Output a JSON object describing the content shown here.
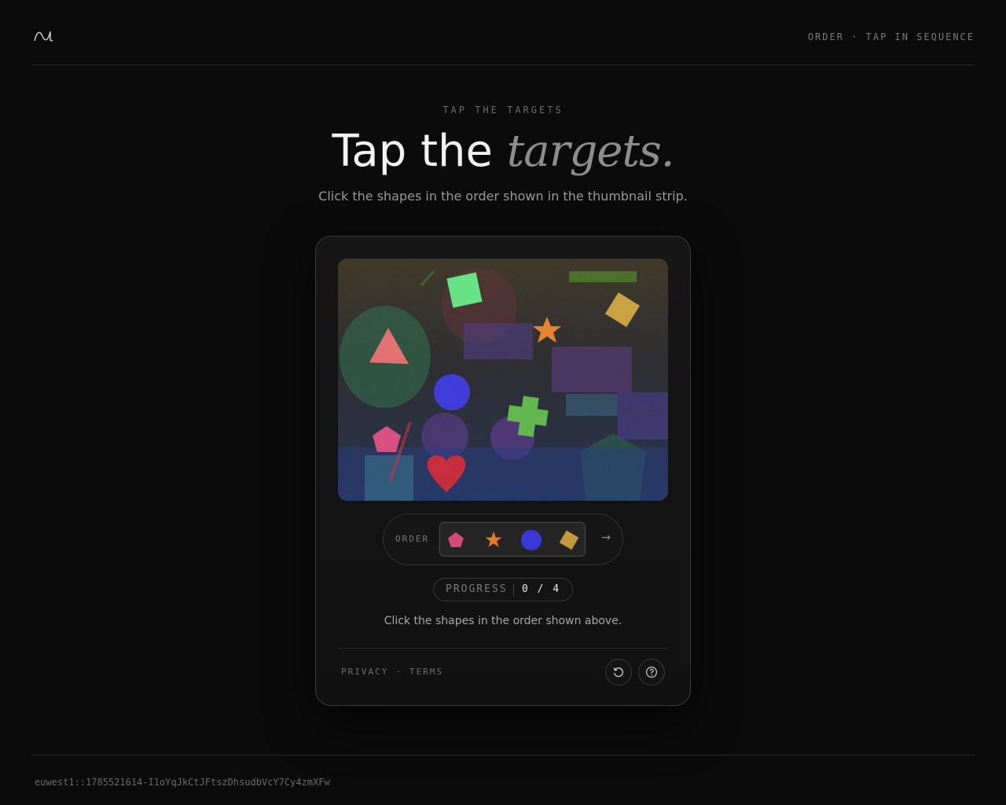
{
  "header": {
    "logo_icon": "wave-logo-icon",
    "status": "ORDER · TAP IN SEQUENCE"
  },
  "hero": {
    "eyebrow": "TAP THE TARGETS",
    "title_plain": "Tap the ",
    "title_emphasis": "targets.",
    "subtitle": "Click the shapes in the order shown in the thumbnail strip."
  },
  "challenge": {
    "canvas_shapes": [
      "square",
      "diamond",
      "star",
      "triangle",
      "circle",
      "cross",
      "pentagon",
      "heart"
    ],
    "order": {
      "label": "ORDER",
      "thumbnails": [
        {
          "shape": "pentagon",
          "color": "#d44a78"
        },
        {
          "shape": "star",
          "color": "#e27a2e"
        },
        {
          "shape": "circle",
          "color": "#3a38d6"
        },
        {
          "shape": "diamond",
          "color": "#c49a3e"
        }
      ],
      "next_icon": "arrow-right-icon"
    },
    "progress": {
      "label": "PROGRESS",
      "value": "0 / 4",
      "current": 0,
      "total": 4
    },
    "instructions": "Click the shapes in the order shown above.",
    "footer": {
      "privacy": "PRIVACY",
      "separator": "·",
      "terms": "TERMS",
      "refresh_icon": "refresh-icon",
      "help_icon": "help-icon"
    }
  },
  "page_footer": {
    "session_id": "euwest1::1785521614-I1oYqJkCtJFtszDhsudbVcY7Cy4zmXFw"
  }
}
